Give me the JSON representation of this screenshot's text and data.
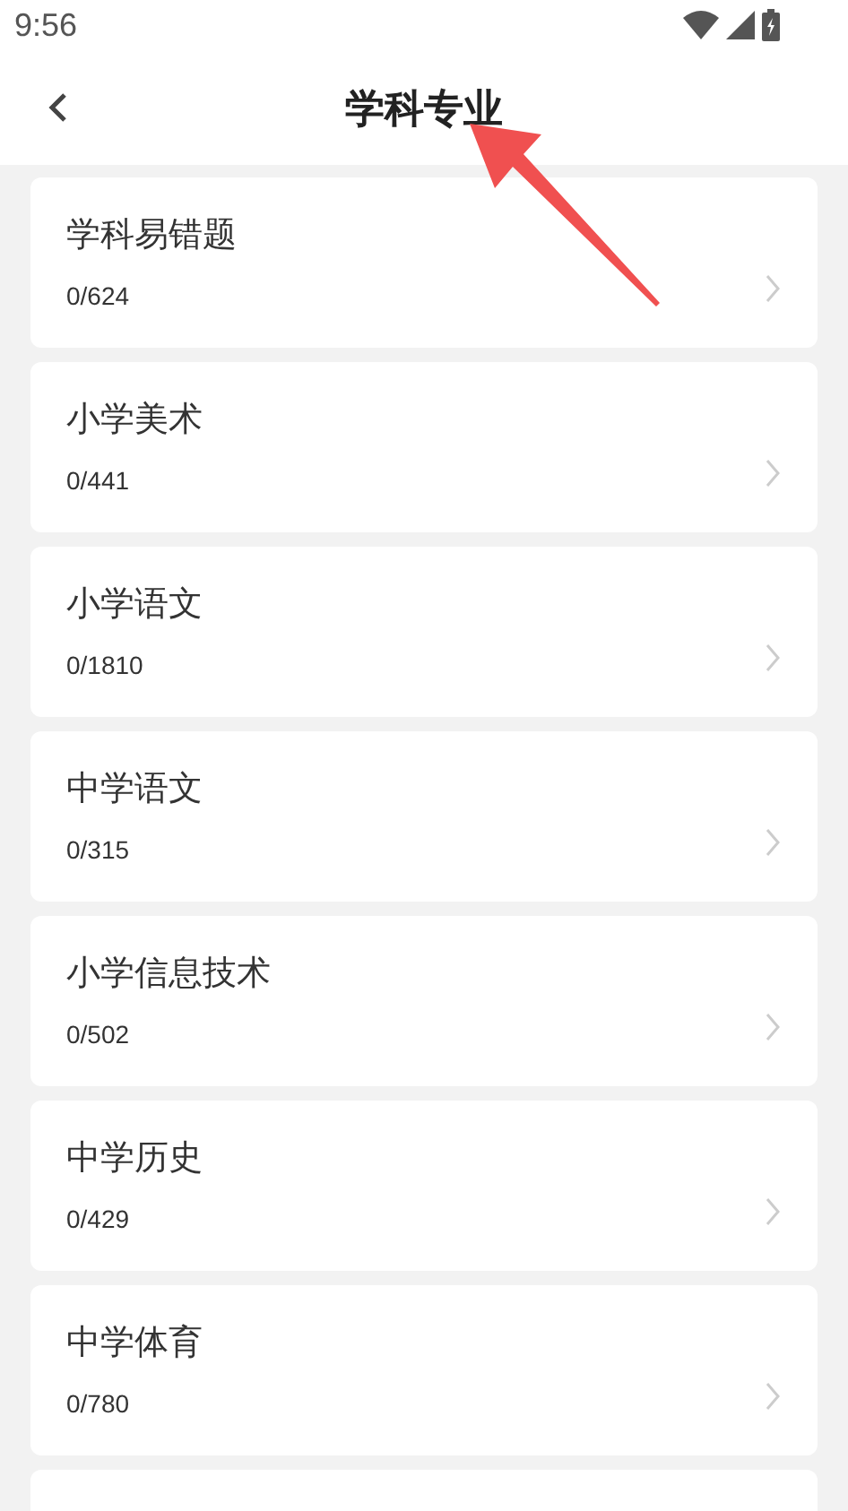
{
  "status_bar": {
    "time": "9:56"
  },
  "header": {
    "title": "学科专业"
  },
  "items": [
    {
      "name": "学科易错题",
      "progress": "0/624"
    },
    {
      "name": "小学美术",
      "progress": "0/441"
    },
    {
      "name": "小学语文",
      "progress": "0/1810"
    },
    {
      "name": "中学语文",
      "progress": "0/315"
    },
    {
      "name": "小学信息技术",
      "progress": "0/502"
    },
    {
      "name": "中学历史",
      "progress": "0/429"
    },
    {
      "name": "中学体育",
      "progress": "0/780"
    }
  ]
}
